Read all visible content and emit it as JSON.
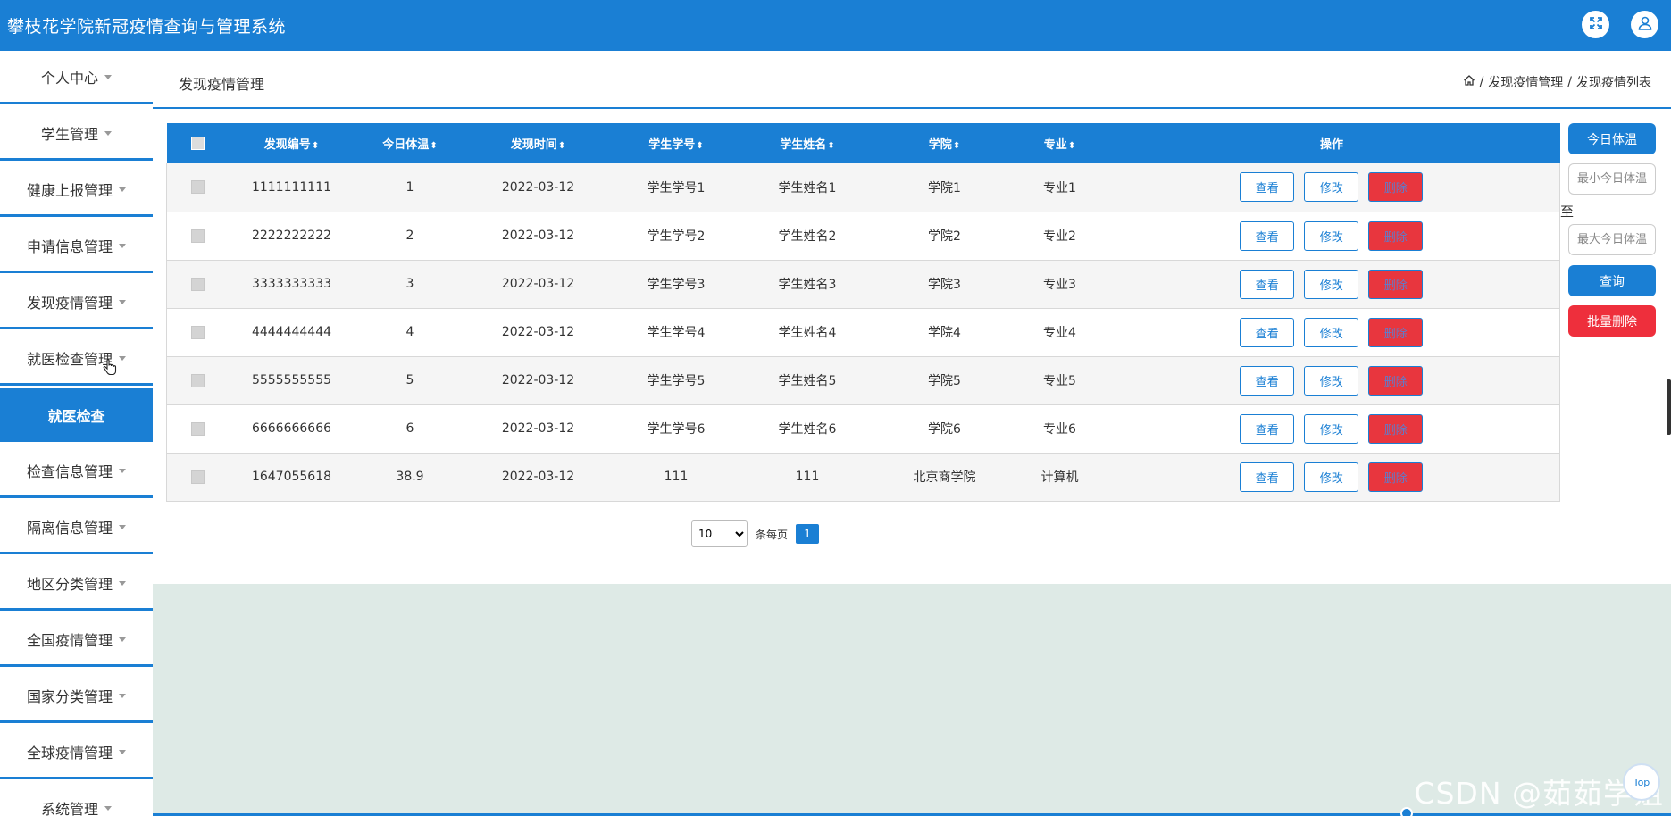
{
  "header": {
    "title": "攀枝花学院新冠疫情查询与管理系统",
    "icons": [
      "fullscreen-icon",
      "user-icon"
    ]
  },
  "sidebar": {
    "items": [
      {
        "label": "个人中心"
      },
      {
        "label": "学生管理"
      },
      {
        "label": "健康上报管理"
      },
      {
        "label": "申请信息管理"
      },
      {
        "label": "发现疫情管理"
      },
      {
        "label": "就医检查管理"
      },
      {
        "label": "就医检查",
        "active": true
      },
      {
        "label": "检查信息管理"
      },
      {
        "label": "隔离信息管理"
      },
      {
        "label": "地区分类管理"
      },
      {
        "label": "全国疫情管理"
      },
      {
        "label": "国家分类管理"
      },
      {
        "label": "全球疫情管理"
      },
      {
        "label": "系统管理"
      }
    ]
  },
  "page": {
    "title": "发现疫情管理",
    "breadcrumb": [
      "发现疫情管理",
      "发现疫情列表"
    ],
    "breadcrumb_sep": "/"
  },
  "table": {
    "columns": [
      "发现编号",
      "今日体温",
      "发现时间",
      "学生学号",
      "学生姓名",
      "学院",
      "专业",
      "操作"
    ],
    "sort_glyph": "⬍",
    "rows": [
      [
        "1111111111",
        "1",
        "2022-03-12",
        "学生学号1",
        "学生姓名1",
        "学院1",
        "专业1"
      ],
      [
        "2222222222",
        "2",
        "2022-03-12",
        "学生学号2",
        "学生姓名2",
        "学院2",
        "专业2"
      ],
      [
        "3333333333",
        "3",
        "2022-03-12",
        "学生学号3",
        "学生姓名3",
        "学院3",
        "专业3"
      ],
      [
        "4444444444",
        "4",
        "2022-03-12",
        "学生学号4",
        "学生姓名4",
        "学院4",
        "专业4"
      ],
      [
        "5555555555",
        "5",
        "2022-03-12",
        "学生学号5",
        "学生姓名5",
        "学院5",
        "专业5"
      ],
      [
        "6666666666",
        "6",
        "2022-03-12",
        "学生学号6",
        "学生姓名6",
        "学院6",
        "专业6"
      ],
      [
        "1647055618",
        "38.9",
        "2022-03-12",
        "111",
        "111",
        "北京商学院",
        "计算机"
      ]
    ],
    "actions": {
      "view": "查看",
      "edit": "修改",
      "delete": "删除"
    }
  },
  "pagination": {
    "page_size": "10",
    "page_size_options": [
      "10"
    ],
    "per_page_label": "条每页",
    "current_page": "1"
  },
  "filter_panel": {
    "title_button": "今日体温",
    "min_placeholder": "最小今日体温",
    "to_label": "至",
    "max_placeholder": "最大今日体温",
    "search_button": "查询",
    "batch_delete_button": "批量删除"
  },
  "footer": {
    "watermark": "CSDN @茹茹学姐",
    "top_button": "Top"
  },
  "colors": {
    "primary": "#1a7fd4",
    "danger": "#e8363e",
    "background_lower": "#deeae6"
  }
}
